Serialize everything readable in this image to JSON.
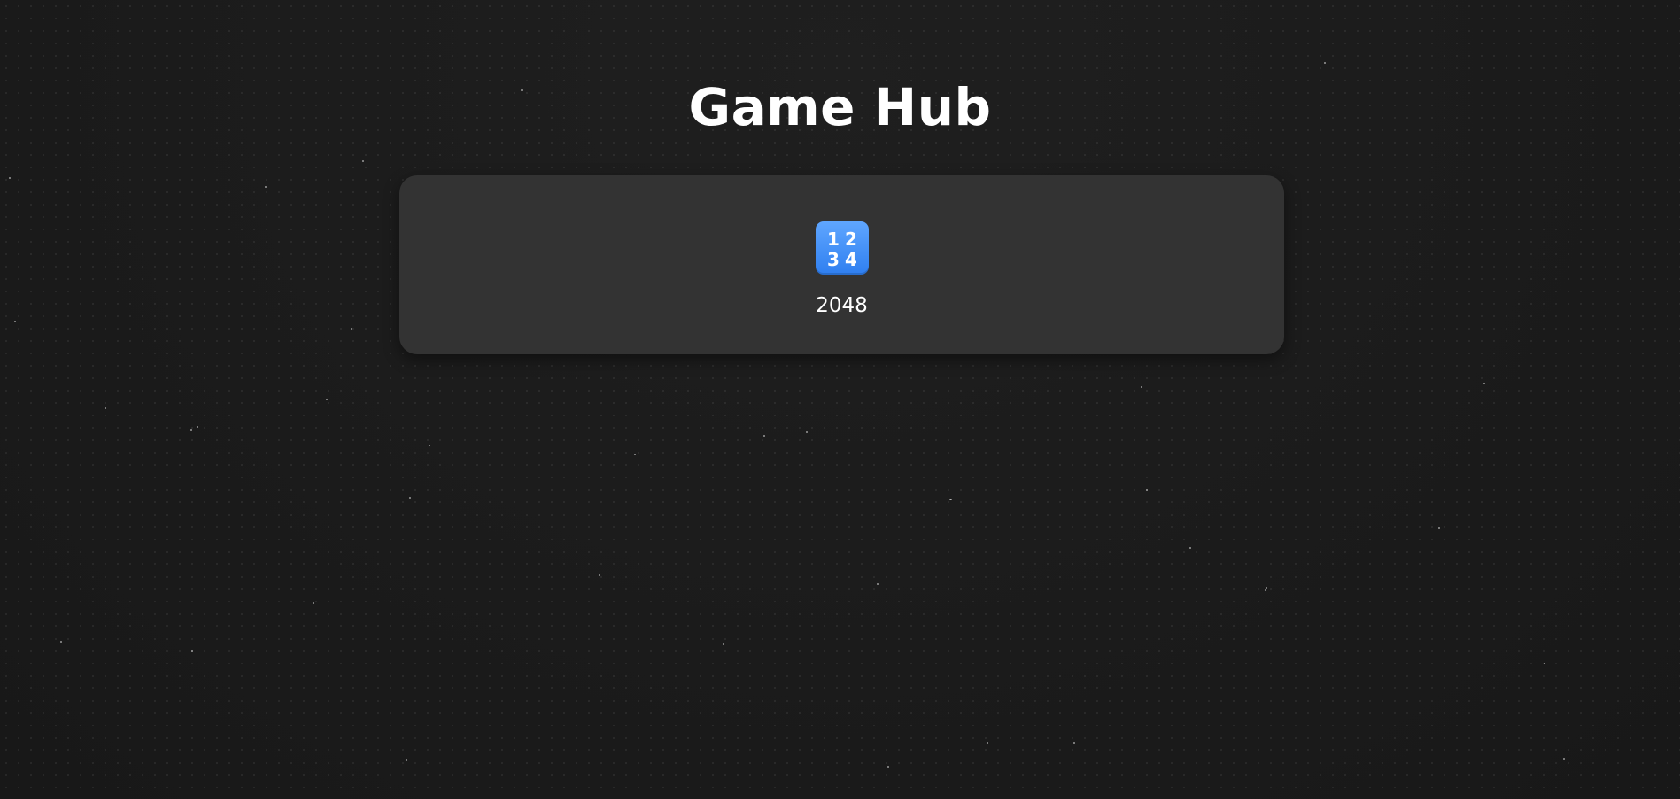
{
  "page": {
    "title": "Game Hub"
  },
  "games": [
    {
      "label": "2048",
      "icon": "numbers-1234-icon",
      "icon_glyphs": [
        "1",
        "2",
        "3",
        "4"
      ],
      "icon_color": "#3b8cf5"
    }
  ],
  "colors": {
    "background": "#1b1b1b",
    "panel": "#333333",
    "text": "#ffffff"
  }
}
